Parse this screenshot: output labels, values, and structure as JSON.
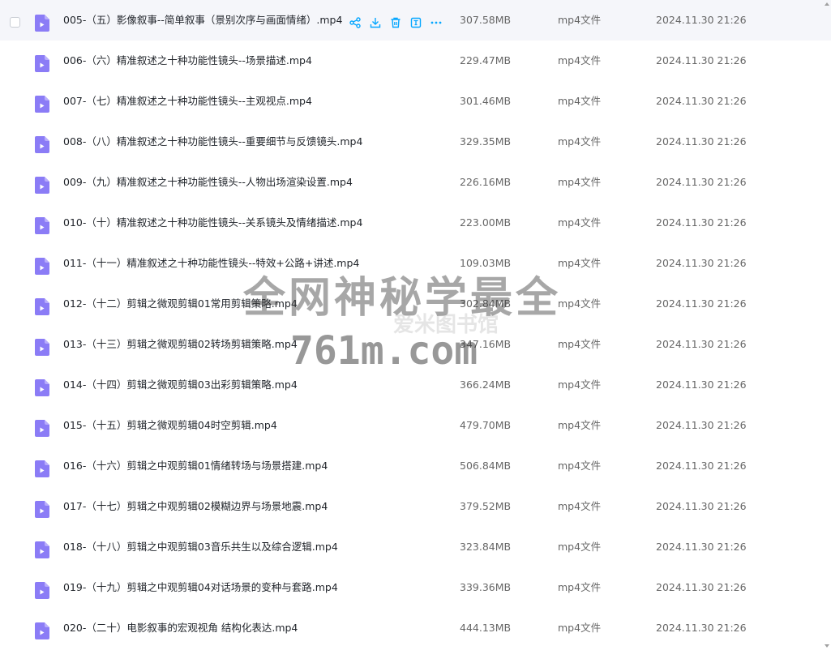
{
  "files": [
    {
      "name": "005-（五）影像叙事--简单叙事（景别次序与画面情绪）.mp4",
      "size": "307.58MB",
      "type": "mp4文件",
      "date": "2024.11.30 21:26"
    },
    {
      "name": "006-（六）精准叙述之十种功能性镜头--场景描述.mp4",
      "size": "229.47MB",
      "type": "mp4文件",
      "date": "2024.11.30 21:26"
    },
    {
      "name": "007-（七）精准叙述之十种功能性镜头--主观视点.mp4",
      "size": "301.46MB",
      "type": "mp4文件",
      "date": "2024.11.30 21:26"
    },
    {
      "name": "008-（八）精准叙述之十种功能性镜头--重要细节与反馈镜头.mp4",
      "size": "329.35MB",
      "type": "mp4文件",
      "date": "2024.11.30 21:26"
    },
    {
      "name": "009-（九）精准叙述之十种功能性镜头--人物出场渲染设置.mp4",
      "size": "226.16MB",
      "type": "mp4文件",
      "date": "2024.11.30 21:26"
    },
    {
      "name": "010-（十）精准叙述之十种功能性镜头--关系镜头及情绪描述.mp4",
      "size": "223.00MB",
      "type": "mp4文件",
      "date": "2024.11.30 21:26"
    },
    {
      "name": "011-（十一）精准叙述之十种功能性镜头--特效+公路+讲述.mp4",
      "size": "109.03MB",
      "type": "mp4文件",
      "date": "2024.11.30 21:26"
    },
    {
      "name": "012-（十二）剪辑之微观剪辑01常用剪辑策略.mp4",
      "size": "302.84MB",
      "type": "mp4文件",
      "date": "2024.11.30 21:26"
    },
    {
      "name": "013-（十三）剪辑之微观剪辑02转场剪辑策略.mp4",
      "size": "347.16MB",
      "type": "mp4文件",
      "date": "2024.11.30 21:26"
    },
    {
      "name": "014-（十四）剪辑之微观剪辑03出彩剪辑策略.mp4",
      "size": "366.24MB",
      "type": "mp4文件",
      "date": "2024.11.30 21:26"
    },
    {
      "name": "015-（十五）剪辑之微观剪辑04时空剪辑.mp4",
      "size": "479.70MB",
      "type": "mp4文件",
      "date": "2024.11.30 21:26"
    },
    {
      "name": "016-（十六）剪辑之中观剪辑01情绪转场与场景搭建.mp4",
      "size": "506.84MB",
      "type": "mp4文件",
      "date": "2024.11.30 21:26"
    },
    {
      "name": "017-（十七）剪辑之中观剪辑02模糊边界与场景地震.mp4",
      "size": "379.52MB",
      "type": "mp4文件",
      "date": "2024.11.30 21:26"
    },
    {
      "name": "018-（十八）剪辑之中观剪辑03音乐共生以及综合逻辑.mp4",
      "size": "323.84MB",
      "type": "mp4文件",
      "date": "2024.11.30 21:26"
    },
    {
      "name": "019-（十九）剪辑之中观剪辑04对话场景的变种与套路.mp4",
      "size": "339.36MB",
      "type": "mp4文件",
      "date": "2024.11.30 21:26"
    },
    {
      "name": "020-（二十）电影叙事的宏观视角 结构化表达.mp4",
      "size": "444.13MB",
      "type": "mp4文件",
      "date": "2024.11.30 21:26"
    }
  ],
  "watermark": {
    "line1": "全网神秘学最全",
    "line2": "761m.com",
    "logo_text": "爱米图书馆"
  },
  "colors": {
    "icon_purple": "#8b7cf6",
    "action_blue": "#06a7ff",
    "hover_bg": "#f5f6fa"
  },
  "icons": {
    "file": "video-file-icon",
    "actions": [
      "share-icon",
      "download-icon",
      "delete-icon",
      "rename-icon",
      "more-icon"
    ]
  }
}
